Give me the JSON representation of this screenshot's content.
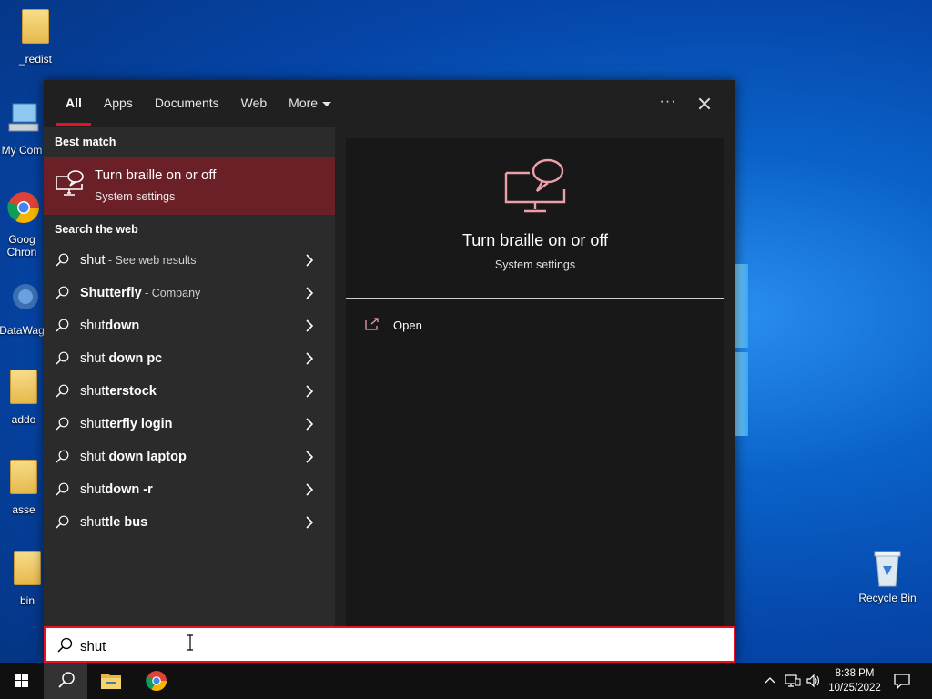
{
  "desktop": {
    "icons": [
      {
        "label": "_redist",
        "icon": "folder-icon"
      },
      {
        "label": "My Com",
        "icon": "computer-icon"
      },
      {
        "label": "Goog",
        "label2": "Chron",
        "icon": "chrome-icon"
      },
      {
        "label": "DataWag",
        "icon": "app-icon"
      },
      {
        "label": "addo",
        "icon": "folder-icon"
      },
      {
        "label": "asse",
        "icon": "folder-icon"
      },
      {
        "label": "bin",
        "icon": "folder-icon"
      }
    ],
    "recycle_bin": "Recycle Bin"
  },
  "search_panel": {
    "tabs": [
      "All",
      "Apps",
      "Documents",
      "Web",
      "More"
    ],
    "active_tab": "All",
    "best_match_heading": "Best match",
    "best_match": {
      "title": "Turn braille on or off",
      "subtitle": "System settings"
    },
    "search_web_heading": "Search the web",
    "web_results": [
      {
        "prefix": "shut",
        "bold": "",
        "suffix": " - See web results"
      },
      {
        "prefix": "Shutterfly",
        "bold": "",
        "suffix": " - Company"
      },
      {
        "prefix": "shut",
        "bold": "down",
        "suffix": ""
      },
      {
        "prefix": "shut",
        "bold": " down pc",
        "suffix": ""
      },
      {
        "prefix": "shut",
        "bold": "terstock",
        "suffix": ""
      },
      {
        "prefix": "shut",
        "bold": "terfly login",
        "suffix": ""
      },
      {
        "prefix": "shut",
        "bold": " down laptop",
        "suffix": ""
      },
      {
        "prefix": "shut",
        "bold": "down -r",
        "suffix": ""
      },
      {
        "prefix": "shut",
        "bold": "tle bus",
        "suffix": ""
      }
    ],
    "preview": {
      "title": "Turn braille on or off",
      "subtitle": "System settings",
      "open_label": "Open"
    },
    "query": "shut"
  },
  "taskbar": {
    "time": "8:38 PM",
    "date": "10/25/2022"
  },
  "colors": {
    "accent_red": "#e81123",
    "best_match_bg": "#6b2028",
    "icon_pink": "#e9a0a8"
  }
}
